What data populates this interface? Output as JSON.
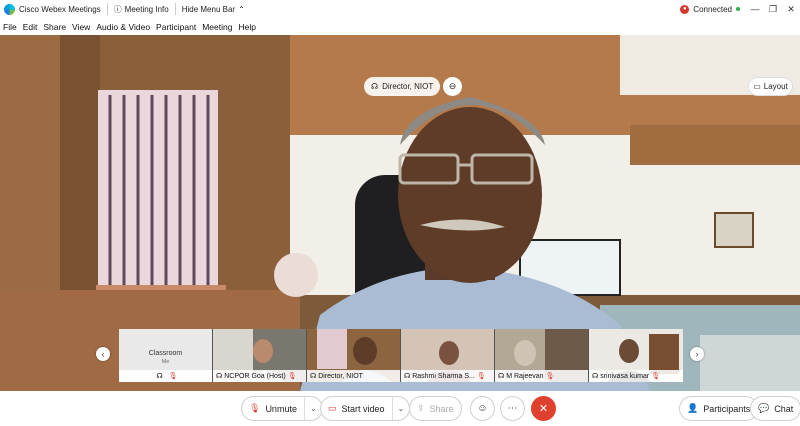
{
  "titlebar": {
    "app_title": "Cisco Webex Meetings",
    "meeting_info": "Meeting Info",
    "hide_menu_bar": "Hide Menu Bar",
    "status": "Connected"
  },
  "menu": [
    "File",
    "Edit",
    "Share",
    "View",
    "Audio & Video",
    "Participant",
    "Meeting",
    "Help"
  ],
  "stage": {
    "active_speaker": "Director, NIOT",
    "layout_label": "Layout"
  },
  "filmstrip": [
    {
      "name": "Classroom",
      "sub": "Me"
    },
    {
      "name": "NCPOR Goa (Host)"
    },
    {
      "name": "Director, NIOT"
    },
    {
      "name": "Rashmi Sharma S..."
    },
    {
      "name": "M Rajeevan"
    },
    {
      "name": "srinivasa kumar"
    }
  ],
  "controls": {
    "unmute": "Unmute",
    "start_video": "Start video",
    "share": "Share",
    "participants": "Participants",
    "chat": "Chat"
  },
  "colors": {
    "end_meeting": "#e0412f",
    "muted_red": "#d7372b",
    "connected_green": "#2fb34b"
  }
}
